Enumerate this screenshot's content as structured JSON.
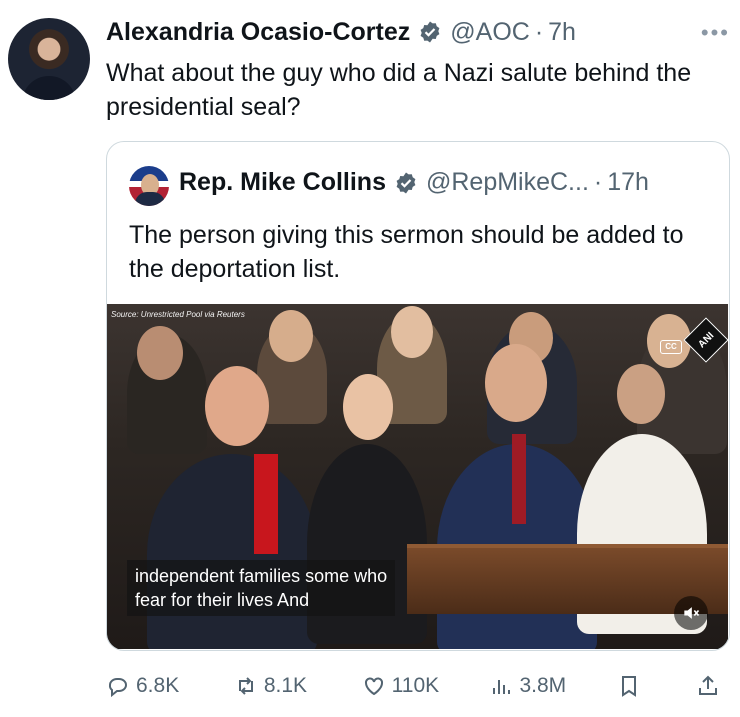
{
  "tweet": {
    "author_name": "Alexandria Ocasio-Cortez",
    "handle": "@AOC",
    "separator": "·",
    "time": "7h",
    "more": "•••",
    "text": "What about the guy who did a Nazi salute behind the presidential seal?"
  },
  "quote": {
    "author_name": "Rep. Mike Collins",
    "handle": "@RepMikeC...",
    "separator": "·",
    "time": "17h",
    "text": "The person giving this sermon should be added to the deportation list.",
    "video": {
      "source_label": "Source: Unrestricted Pool via Reuters",
      "cc_label": "CC",
      "watermark": "ANI",
      "caption_lines": [
        "independent families some who",
        "fear for their lives And"
      ]
    }
  },
  "actions": {
    "replies": "6.8K",
    "reposts": "8.1K",
    "likes": "110K",
    "views": "3.8M"
  },
  "colors": {
    "verified": "#1d9bf0",
    "muted_text": "#536471",
    "border": "#cfd9de"
  },
  "icons": [
    "verified-badge-icon",
    "more-icon",
    "reply-icon",
    "repost-icon",
    "like-icon",
    "views-icon",
    "bookmark-icon",
    "share-icon",
    "mute-icon"
  ]
}
